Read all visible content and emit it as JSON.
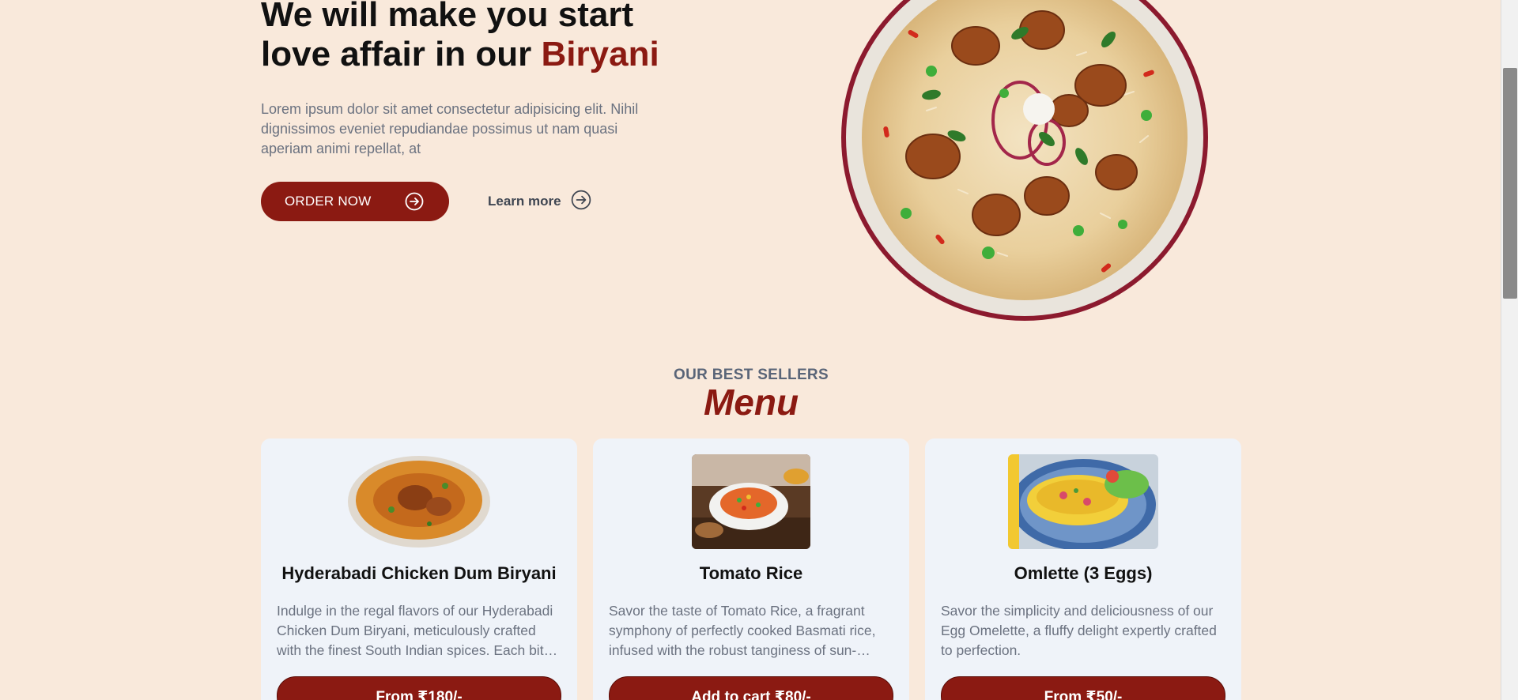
{
  "hero": {
    "title_line1": "We will make you start",
    "title_line2_prefix": "love affair in our ",
    "title_accent": "Biryani",
    "description": "Lorem ipsum dolor sit amet consectetur adipisicing elit. Nihil dignissimos eveniet repudiandae possimus ut nam quasi aperiam animi repellat, at",
    "order_button": "ORDER NOW",
    "learn_more": "Learn more",
    "order_icon": "arrow-right-circle-icon",
    "learn_icon": "arrow-right-circle-icon"
  },
  "menu_section": {
    "subtitle": "OUR BEST SELLERS",
    "title": "Menu"
  },
  "menu_items": [
    {
      "name": "Hyderabadi Chicken Dum Biryani",
      "description": "Indulge in the regal flavors of our Hyderabadi Chicken Dum Biryani, meticulously crafted with the finest South Indian spices. Each bite is a celebration of taste.",
      "button": "From ₹180/-",
      "image": "biryani-plate-image"
    },
    {
      "name": "Tomato Rice",
      "description": "Savor the taste of Tomato Rice, a fragrant symphony of perfectly cooked Basmati rice, infused with the robust tanginess of sun-ripened tomatoes.",
      "button": "Add to cart ₹80/-",
      "image": "tomato-rice-image"
    },
    {
      "name": "Omlette (3 Eggs)",
      "description": "Savor the simplicity and deliciousness of our Egg Omelette, a fluffy delight expertly crafted to perfection.",
      "button": "From ₹50/-",
      "image": "omelette-image"
    }
  ],
  "colors": {
    "background": "#f9e9db",
    "accent": "#8b1a12",
    "card": "#eff3f9",
    "muted_text": "#6b7280"
  }
}
